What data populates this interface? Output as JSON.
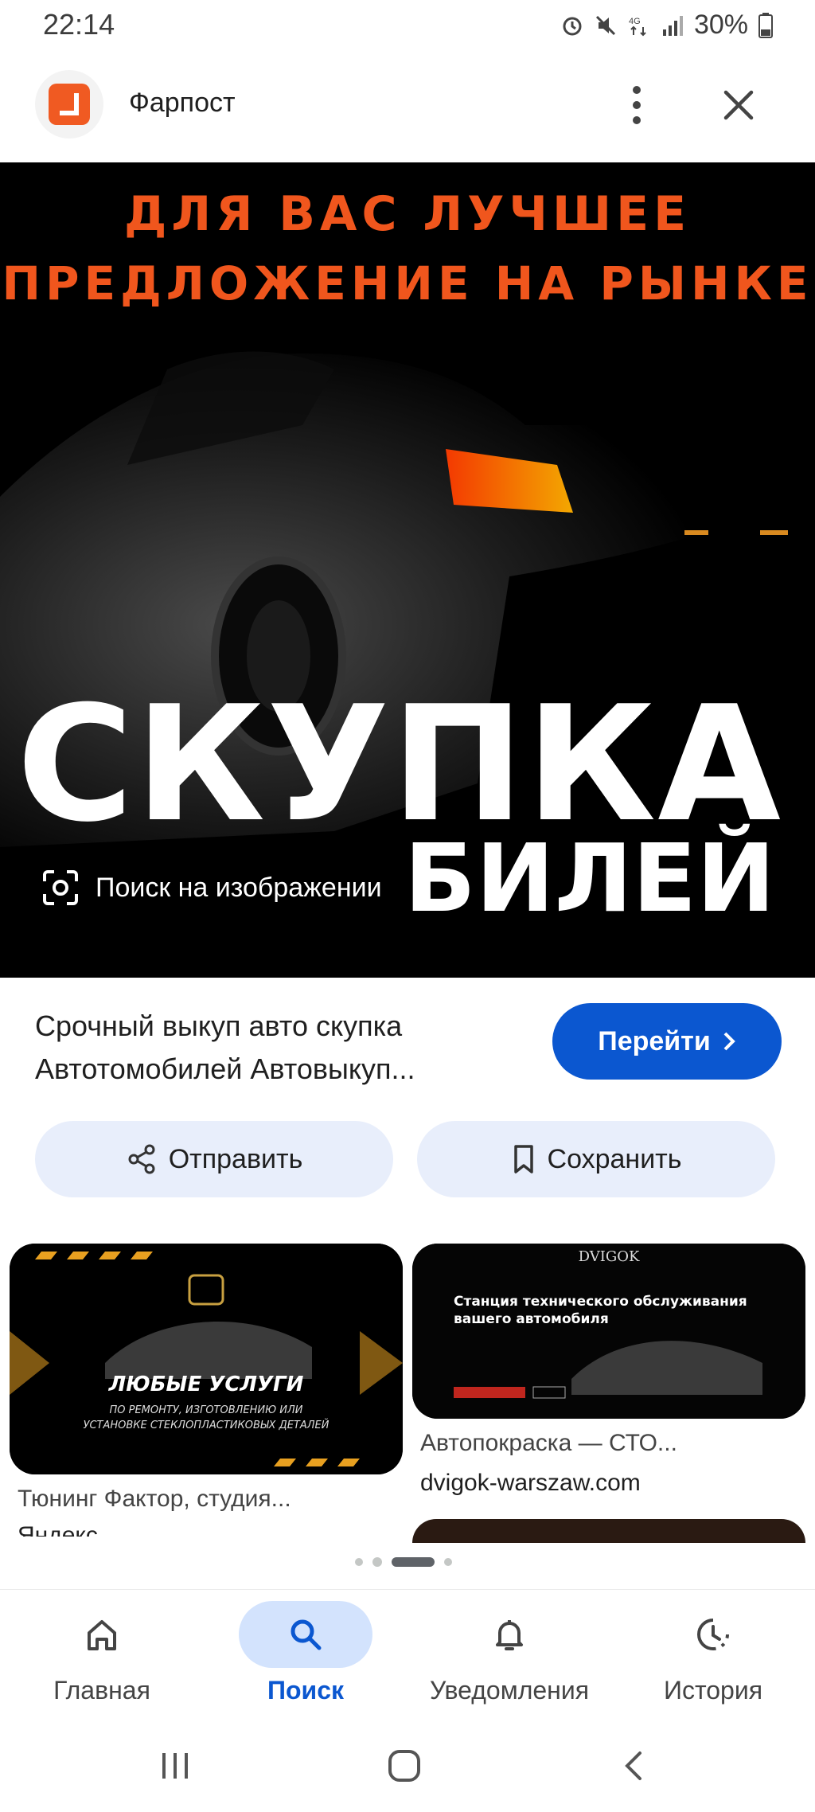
{
  "status_bar": {
    "time": "22:14",
    "battery": "30%"
  },
  "header": {
    "site_name": "Фарпост"
  },
  "hero": {
    "tagline_line1": "ДЛЯ ВАС ЛУЧШЕЕ",
    "tagline_line2": "ПРЕДЛОЖЕНИЕ НА РЫНКЕ",
    "headline": "СКУПКА",
    "subheadline": "БИЛЕЙ",
    "lens_label": "Поиск на изображении"
  },
  "result": {
    "caption_line1": "Срочный выкуп авто скупка",
    "caption_line2": "Автотомобилей Автовыкуп...",
    "go_label": "Перейти"
  },
  "actions": {
    "share_label": "Отправить",
    "save_label": "Сохранить"
  },
  "related": [
    {
      "title": "Тюнинг Фактор, студия...",
      "source": "Яндекс",
      "thumb_heading": "ЛЮБЫЕ УСЛУГИ",
      "thumb_sub1": "ПО РЕМОНТУ, ИЗГОТОВЛЕНИЮ ИЛИ",
      "thumb_sub2": "УСТАНОВКЕ СТЕКЛОПЛАСТИКОВЫХ ДЕТАЛЕЙ"
    },
    {
      "title": "Автопокраска — СТО...",
      "source": "dvigok-warszaw.com",
      "thumb_logo": "DVIGOK",
      "thumb_heading1": "Станция технического обслуживания",
      "thumb_heading2": "вашего автомобиля"
    }
  ],
  "bottom_nav": [
    {
      "label": "Главная",
      "icon": "home-icon"
    },
    {
      "label": "Поиск",
      "icon": "search-icon",
      "active": true
    },
    {
      "label": "Уведомления",
      "icon": "bell-icon"
    },
    {
      "label": "История",
      "icon": "history-icon"
    }
  ],
  "colors": {
    "accent": "#0b57d0",
    "tagline": "#f0561d",
    "pill_bg": "#e8eefb"
  }
}
